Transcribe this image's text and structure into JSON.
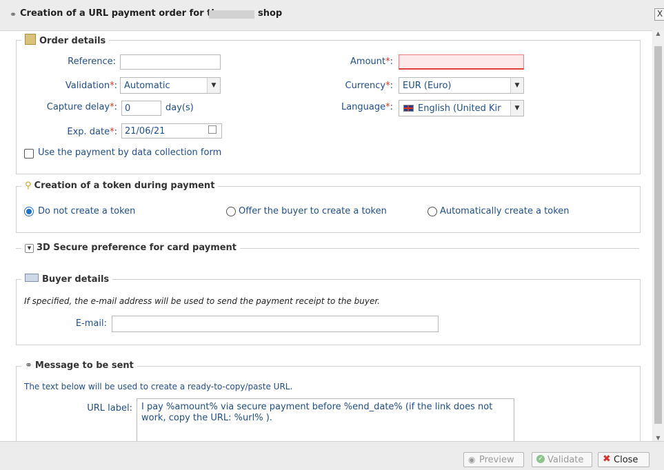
{
  "window": {
    "title_prefix": "Creation of a URL payment order for the",
    "title_suffix": "shop",
    "close_symbol": "X"
  },
  "order_details": {
    "legend": "Order details",
    "reference": {
      "label": "Reference:",
      "value": ""
    },
    "amount": {
      "label": "Amount",
      "value": ""
    },
    "validation": {
      "label": "Validation",
      "value": "Automatic"
    },
    "currency": {
      "label": "Currency",
      "value": "EUR (Euro)"
    },
    "capture_delay": {
      "label": "Capture delay",
      "value": "0",
      "unit": "day(s)"
    },
    "language": {
      "label": "Language",
      "value": "English (United Kir"
    },
    "exp_date": {
      "label": "Exp. date",
      "value": "21/06/21"
    },
    "required_mark": "*",
    "colon": ":",
    "data_form_checkbox": {
      "label": "Use the payment by data collection form",
      "checked": false
    }
  },
  "token": {
    "legend": "Creation of a token during payment",
    "options": [
      {
        "label": "Do not create a token",
        "selected": true
      },
      {
        "label": "Offer the buyer to create a token",
        "selected": false
      },
      {
        "label": "Automatically create a token",
        "selected": false
      }
    ]
  },
  "secure3d": {
    "legend": "3D Secure preference for card payment"
  },
  "buyer": {
    "legend": "Buyer details",
    "note": "If specified, the e-mail address will be used to send the payment receipt to the buyer.",
    "email": {
      "label": "E-mail:",
      "value": ""
    }
  },
  "message": {
    "legend": "Message to be sent",
    "note": "The text below will be used to create a ready-to-copy/paste URL.",
    "url_label": {
      "label": "URL label:",
      "value": "I pay %amount% via secure payment before %end_date% (if the link does not work, copy the URL: %url% )."
    }
  },
  "footer": {
    "preview": "Preview",
    "validate": "Validate",
    "close": "Close"
  },
  "colors": {
    "label_blue": "#1f4e8c",
    "required_red": "#e8341b",
    "radio_blue": "#1f6fd1",
    "amount_error_bg": "#fde9e9"
  }
}
